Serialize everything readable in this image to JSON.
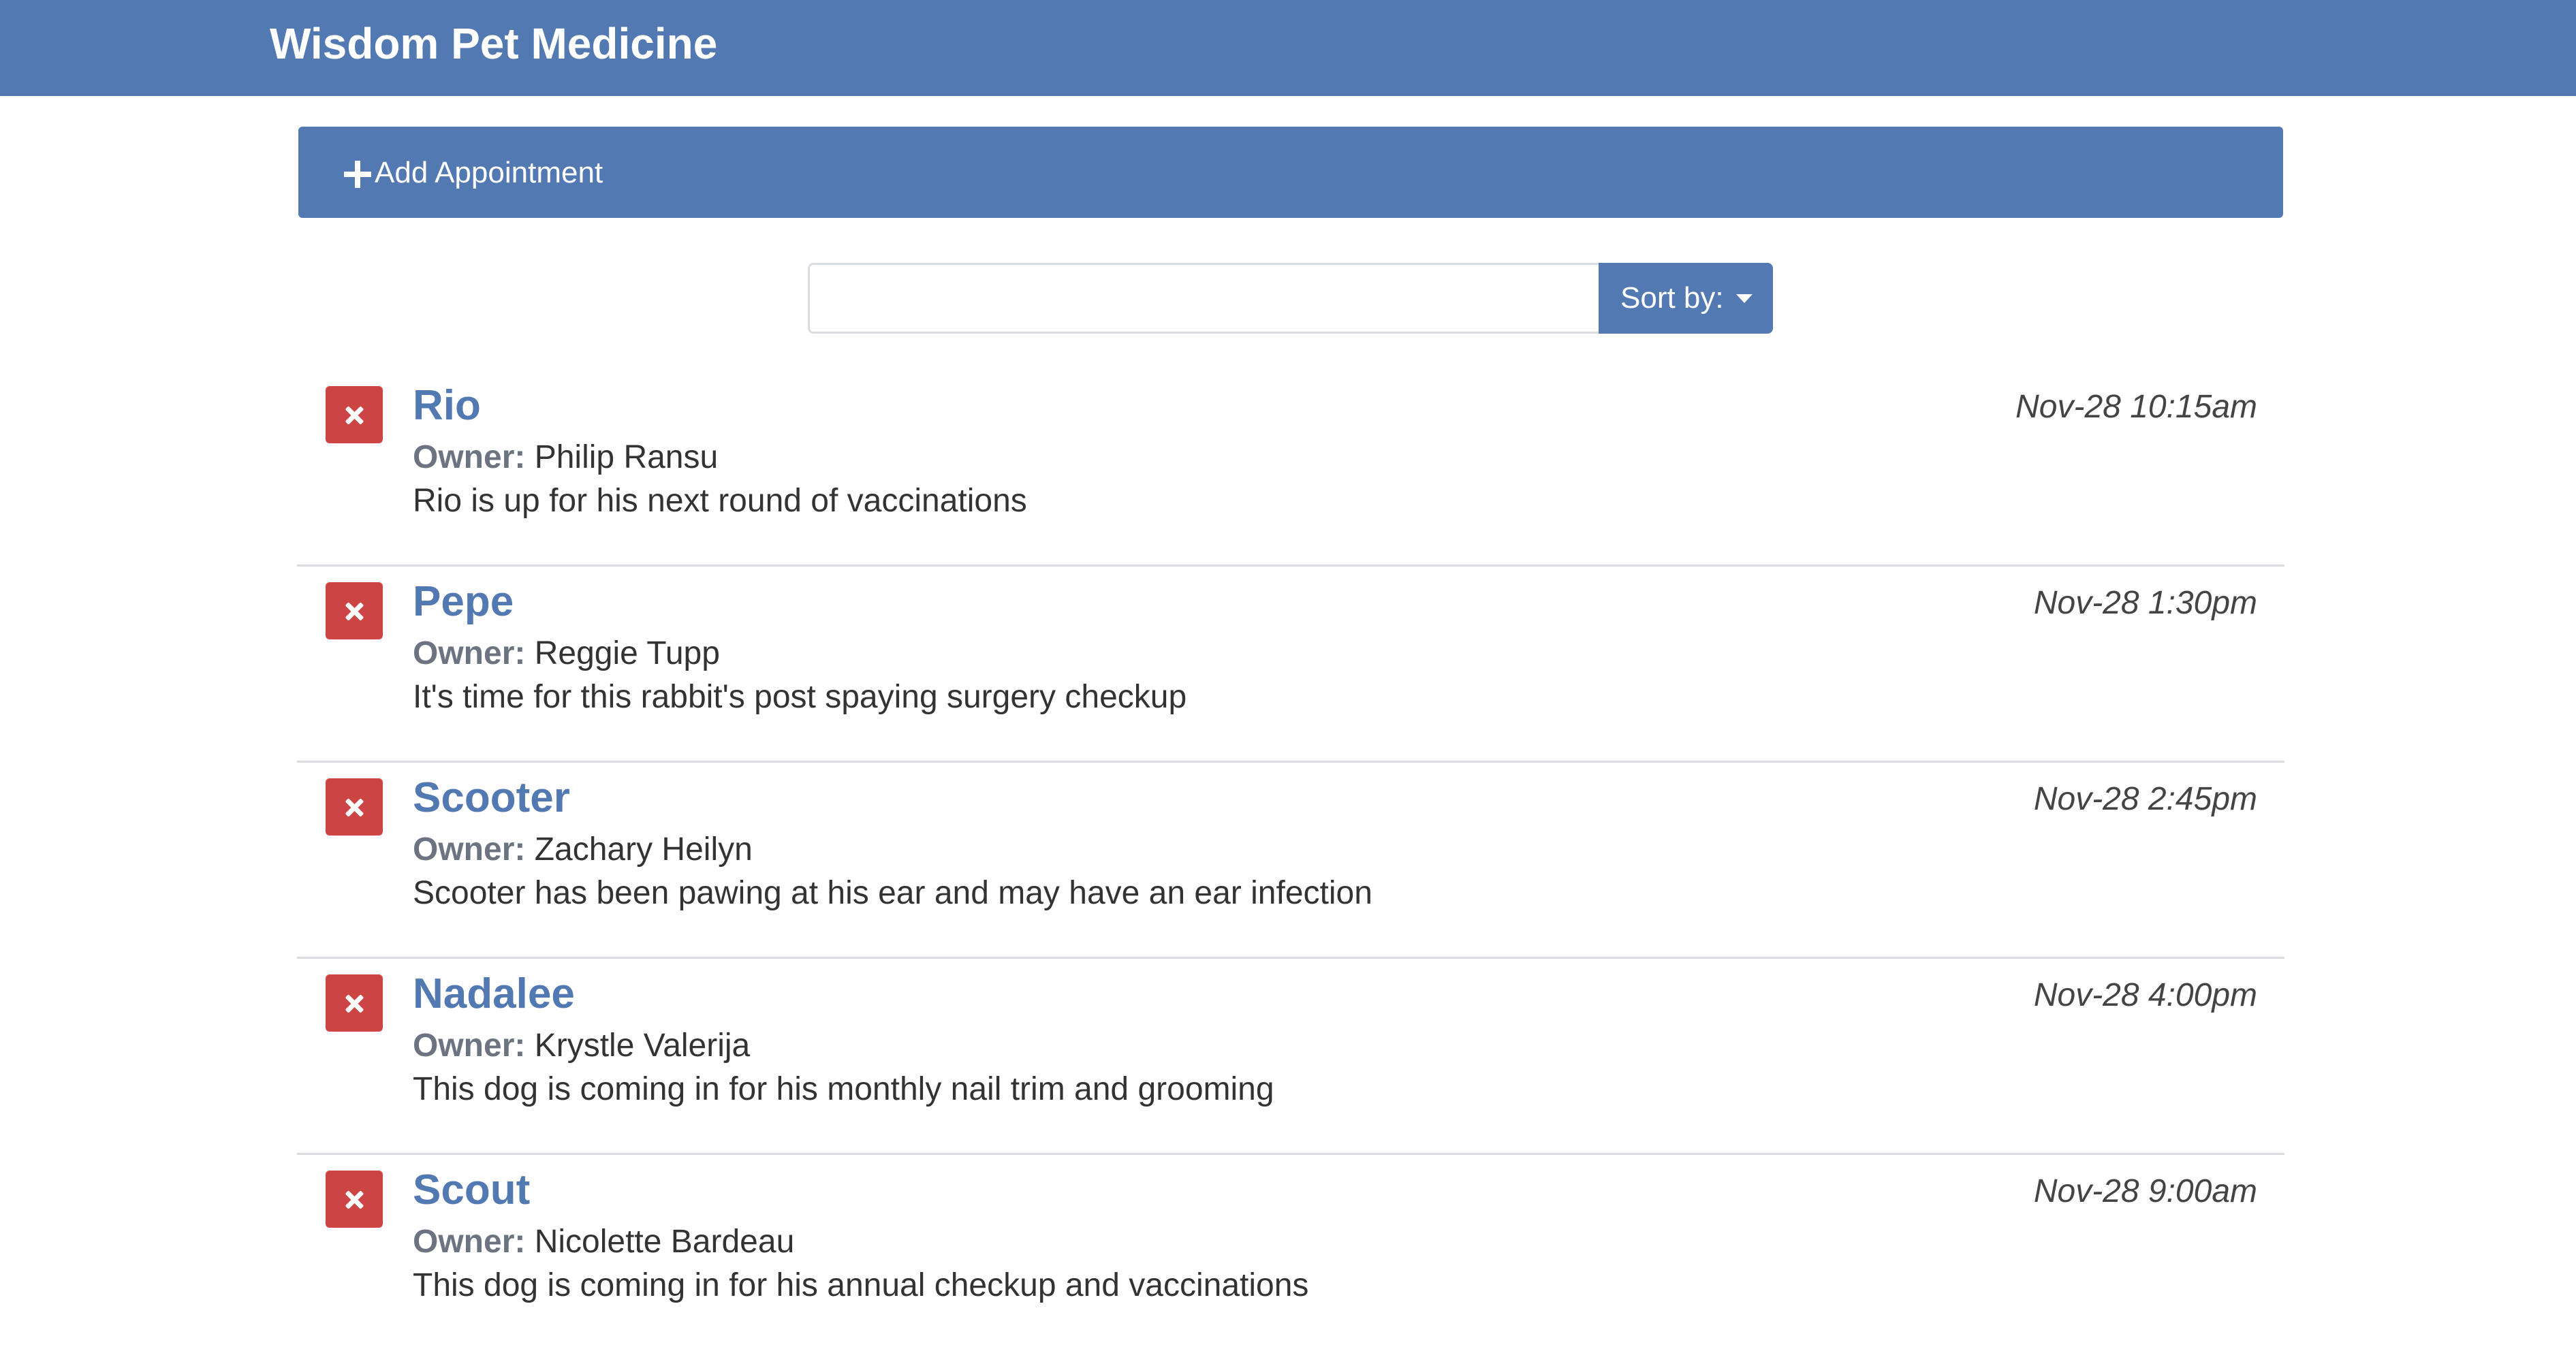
{
  "header": {
    "title": "Wisdom Pet Medicine"
  },
  "add_appointment": {
    "label": "Add Appointment",
    "icon": "plus-icon"
  },
  "search": {
    "value": "",
    "placeholder": ""
  },
  "sort": {
    "label": "Sort by:",
    "icon": "caret-down-icon"
  },
  "owner_label": "Owner:",
  "appointments": [
    {
      "pet_name": "Rio",
      "date": "Nov-28 10:15am",
      "owner": "Philip Ransu",
      "notes": "Rio is up for his next round of vaccinations"
    },
    {
      "pet_name": "Pepe",
      "date": "Nov-28 1:30pm",
      "owner": "Reggie Tupp",
      "notes": "It's time for this rabbit's post spaying surgery checkup"
    },
    {
      "pet_name": "Scooter",
      "date": "Nov-28 2:45pm",
      "owner": "Zachary Heilyn",
      "notes": "Scooter has been pawing at his ear and may have an ear infection"
    },
    {
      "pet_name": "Nadalee",
      "date": "Nov-28 4:00pm",
      "owner": "Krystle Valerija",
      "notes": "This dog is coming in for his monthly nail trim and grooming"
    },
    {
      "pet_name": "Scout",
      "date": "Nov-28 9:00am",
      "owner": "Nicolette Bardeau",
      "notes": "This dog is coming in for his annual checkup and vaccinations"
    }
  ],
  "colors": {
    "brand": "#5379b3",
    "delete": "#cc4444",
    "divider": "#dadcdf"
  }
}
